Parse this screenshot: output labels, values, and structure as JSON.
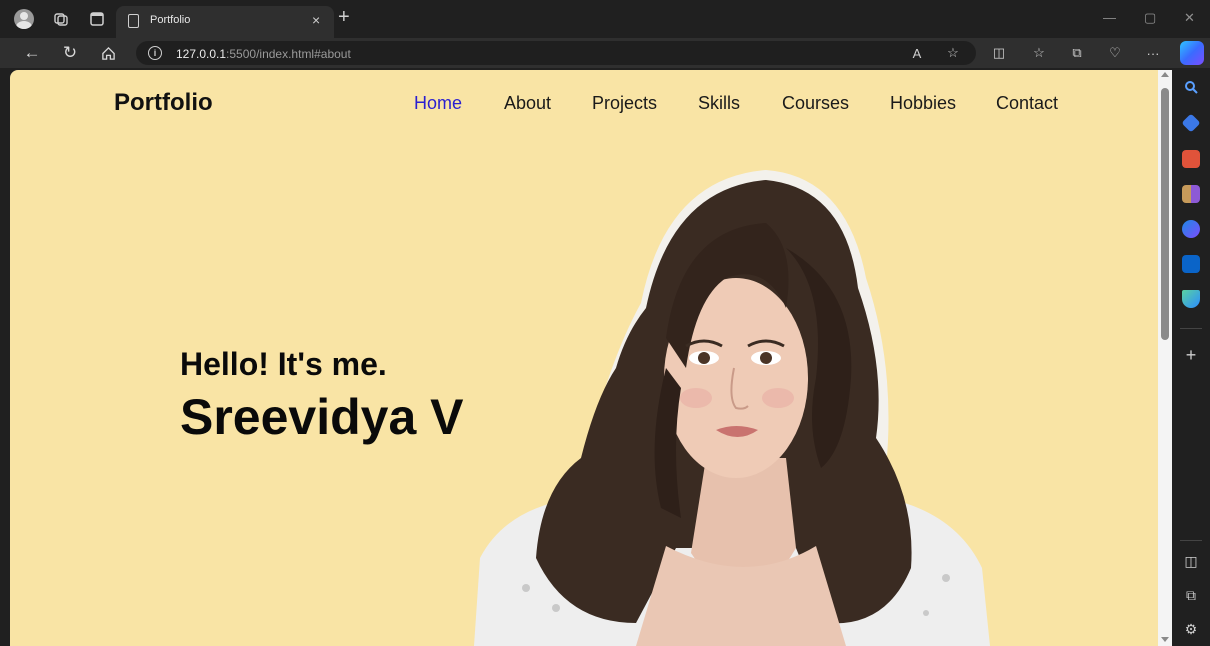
{
  "browser": {
    "tab_title": "Portfolio",
    "tab_close": "×",
    "new_tab": "+",
    "url_host": "127.0.0.1",
    "url_rest": ":5500/index.html#about",
    "info_glyph": "i",
    "more_glyph": "···",
    "add_glyph": "+"
  },
  "site": {
    "brand": "Portfolio",
    "nav": [
      "Home",
      "About",
      "Projects",
      "Skills",
      "Courses",
      "Hobbies",
      "Contact"
    ],
    "active_nav": "Home",
    "greeting": "Hello! It's me.",
    "name": "Sreevidya V"
  },
  "colors": {
    "page_background": "#f9e4a5",
    "active_link": "#2a1fd0",
    "text": "#0a0a0a"
  },
  "icons": [
    "profile-avatar-icon",
    "workspaces-icon",
    "tab-actions-icon",
    "back-icon",
    "refresh-icon",
    "home-icon",
    "read-aloud-icon",
    "favorite-star-icon",
    "split-screen-icon",
    "favorites-icon",
    "collections-icon",
    "browser-essentials-icon",
    "more-icon",
    "copilot-icon",
    "search-icon",
    "shopping-icon",
    "tools-icon",
    "games-icon",
    "m365-icon",
    "outlook-icon",
    "drop-icon",
    "add-icon",
    "sidebar-toggle-icon",
    "external-icon",
    "settings-icon"
  ]
}
